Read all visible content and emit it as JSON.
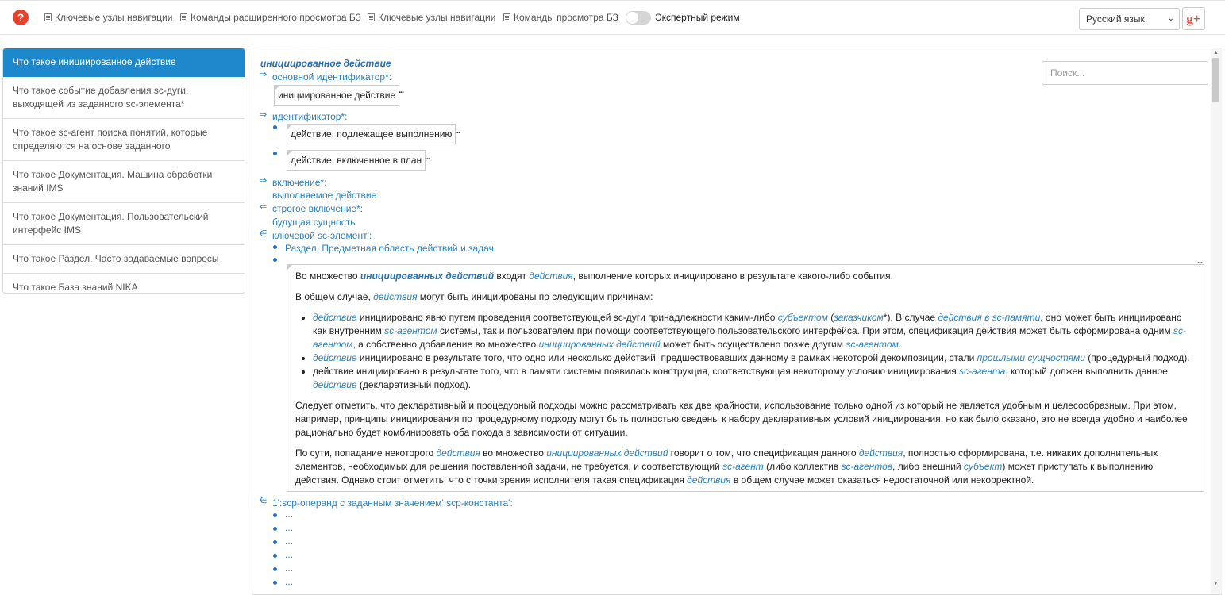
{
  "header": {
    "help_icon": "?",
    "nav": [
      "Ключевые узлы навигации",
      "Команды расширенного просмотра БЗ",
      "Ключевые узлы навигации",
      "Команды просмотра БЗ"
    ],
    "expert_mode_label": "Экспертный режим",
    "language": "Русский язык",
    "gplus": "g+"
  },
  "sidebar": {
    "items": [
      "Что такое инициированное действие",
      "Что такое событие добавления sc-дуги, выходящей из заданного sc-элемента*",
      "Что такое sc-агент поиска понятий, которые определяются на основе заданного",
      "Что такое Документация. Машина обработки знаний IMS",
      "Что такое Документация. Пользовательский интерфейс IMS",
      "Что такое Раздел. Часто задаваемые вопросы",
      "Что такое База знаний NIKA"
    ]
  },
  "search": {
    "placeholder": "Поиск..."
  },
  "article": {
    "title": "инициированное действие",
    "rel_main_id": "основной идентификатор*:",
    "main_id_value": "инициированное действие",
    "rel_id": "идентификатор*:",
    "id_values": [
      "действие, подлежащее выполнению",
      "действие, включенное в план"
    ],
    "rel_inclusion": "включение*:",
    "inclusion_value": "выполняемое действие",
    "rel_strict": "строгое включение*:",
    "strict_value": "будущая сущность",
    "rel_key": "ключевой sc-элемент':",
    "key_value": "Раздел. Предметная область действий и задач",
    "rel_operand": "1':scp-операнд с заданным значением':scp-константа':",
    "ellipsis": "...",
    "arrow_right": "⇒",
    "arrow_left": "⇐",
    "member": "∈"
  },
  "definition": {
    "p1": [
      "Во множество ",
      "инициированных действий",
      " входят ",
      "действия",
      ", выполнение которых инициировано в результате какого-либо события."
    ],
    "p2": [
      "В общем случае, ",
      "действия",
      " могут быть инициированы по следующим причинам:"
    ],
    "li1": [
      "действие",
      " инициировано явно путем проведения соответствующей sc-дуги принадлежности каким-либо ",
      "субъектом",
      " (",
      "заказчиком",
      "*). В случае ",
      "действия в sc-памяти",
      ", оно может быть инициировано как внутренним ",
      "sc-агентом",
      " системы, так и пользователем при помощи соответствующего пользовательского интерфейса. При этом, спецификация действия может быть сформирована одним ",
      "sc-агентом",
      ", а собственно добавление во множество ",
      "инициированных действий",
      " может быть осуществлено позже другим ",
      "sc-агентом",
      "."
    ],
    "li2": [
      "действие",
      " инициировано в результате того, что одно или несколько действий, предшествовавших данному в рамках некоторой декомпозиции, стали ",
      "прошлыми сущностями",
      " (процедурный подход)."
    ],
    "li3": [
      "действие инициировано в результате того, что в памяти системы появилась конструкция, соответствующая некоторому условию инициирования ",
      "sc-агента",
      ", который должен выполнить данное ",
      "действие",
      " (декларативный подход)."
    ],
    "p3": "Следует отметить, что декларативный и процедурный подходы можно рассматривать как две крайности, использование только одной из который не является удобным и целесообразным. При этом, например, принципы инициирования по процедурному подходу могут быть полностью сведены к набору декларативных условий инициирования, но как было сказано, это не всегда удобно и наиболее рационально будет комбинировать оба похода в зависимости от ситуации.",
    "p4": [
      "По сути, попадание некоторого ",
      "действия",
      " во множество ",
      "инициированных действий",
      " говорит о том, что спецификация данного ",
      "действия",
      ", полностью сформирована, т.е. никаких дополнительных элементов, необходимых для решения поставленной задачи, не требуется, и соответствующий ",
      "sc-агент",
      " (либо коллектив ",
      "sc-агентов",
      ", либо внешний ",
      "субъект",
      ") может приступать к выполнению действия. Однако стоит отметить, что с точки зрения исполнителя такая спецификация ",
      "действия",
      " в общем случае может оказаться недостаточной или некорректной."
    ]
  }
}
